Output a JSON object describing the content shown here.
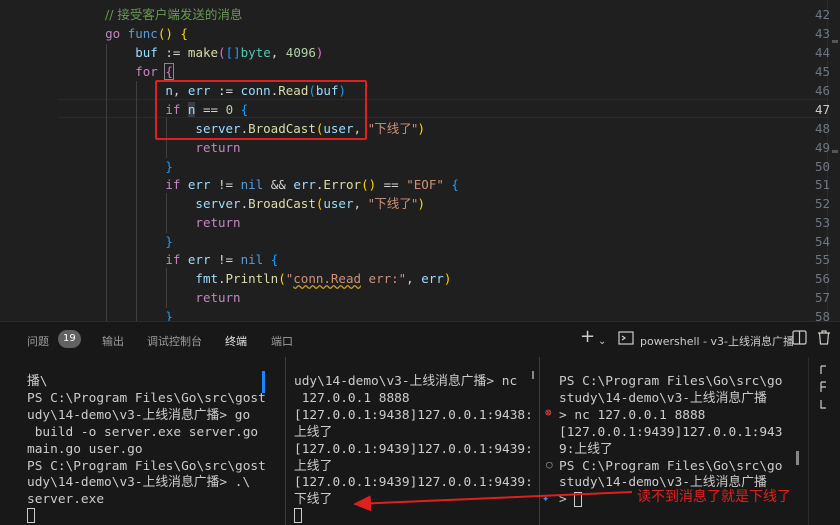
{
  "editor": {
    "line_numbers": [
      "42",
      "43",
      "44",
      "45",
      "46",
      "47",
      "48",
      "49",
      "50",
      "51",
      "52",
      "53",
      "54",
      "55",
      "56",
      "57",
      "58"
    ],
    "code": {
      "l42_comment": "// 接受客户端发送的消息",
      "l43_go": "go",
      "l43_func": "func",
      "l44_buf": "buf",
      "l44_assign": ":=",
      "l44_make": "make",
      "l44_type": "byte",
      "l44_num": "4096",
      "l45_for": "for",
      "l46_n": "n",
      "l46_err": "err",
      "l46_assign": ":=",
      "l46_conn": "conn",
      "l46_read": "Read",
      "l46_buf": "buf",
      "l47_if": "if",
      "l47_n": "n",
      "l47_op": "==",
      "l47_num": "0",
      "l48_server": "server",
      "l48_fn": "BroadCast",
      "l48_user": "user",
      "l48_str": "\"下线了\"",
      "l49_return": "return",
      "l51_if": "if",
      "l51_err": "err",
      "l51_ne": "!=",
      "l51_nil": "nil",
      "l51_and": "&&",
      "l51_err2": "err",
      "l51_error": "Error",
      "l51_eq": "==",
      "l51_str": "\"EOF\"",
      "l52_server": "server",
      "l52_fn": "BroadCast",
      "l52_user": "user",
      "l52_str": "\"下线了\"",
      "l53_return": "return",
      "l55_if": "if",
      "l55_err": "err",
      "l55_ne": "!=",
      "l55_nil": "nil",
      "l56_fmt": "fmt",
      "l56_fn": "Println",
      "l56_str_a": "\"",
      "l56_str_b": "conn.Read",
      "l56_str_c": " err:\"",
      "l56_err": "err",
      "l57_return": "return"
    }
  },
  "panel": {
    "tabs": [
      "问题",
      "输出",
      "调试控制台",
      "终端",
      "端口"
    ],
    "problems_count": "19",
    "active_tab": "终端",
    "terminal_label": "powershell - v3-上线消息广播",
    "icons": [
      "plus-icon",
      "chevron-down-icon",
      "terminal-icon",
      "split-icon",
      "trash-icon"
    ]
  },
  "terminals": {
    "t1": [
      "播\\",
      "PS C:\\Program Files\\Go\\src\\gost",
      "udy\\14-demo\\v3-上线消息广播> go",
      " build -o server.exe server.go",
      "main.go user.go",
      "PS C:\\Program Files\\Go\\src\\gost",
      "udy\\14-demo\\v3-上线消息广播> .\\",
      "server.exe"
    ],
    "t2": [
      "udy\\14-demo\\v3-上线消息广播> nc",
      " 127.0.0.1 8888",
      "[127.0.0.1:9438]127.0.0.1:9438:",
      "上线了",
      "[127.0.0.1:9439]127.0.0.1:9439:",
      "上线了",
      "[127.0.0.1:9439]127.0.0.1:9439:",
      "下线了"
    ],
    "t3": [
      "PS C:\\Program Files\\Go\\src\\go",
      "study\\14-demo\\v3-上线消息广播",
      "> nc 127.0.0.1 8888",
      "[127.0.0.1:9439]127.0.0.1:943",
      "9:上线了",
      "PS C:\\Program Files\\Go\\src\\go",
      "study\\14-demo\\v3-上线消息广播",
      ">"
    ]
  },
  "annotation": "读不到消息了就是下线了",
  "colors": {
    "highlight_box": "#e0201e",
    "background": "#1f1f1f"
  }
}
